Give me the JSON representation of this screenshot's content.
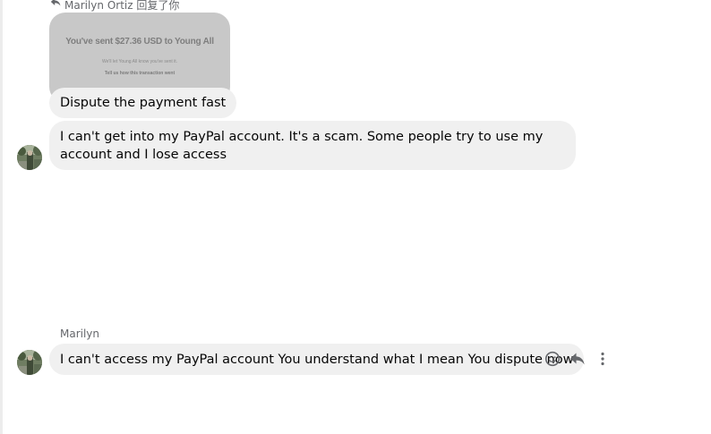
{
  "reply_header": {
    "icon": "reply-arrow-icon",
    "text": "Marilyn Ortiz 回复了你"
  },
  "shared_image": {
    "headline": "You've sent $27.36 USD to Young All",
    "subtext": "We'll let Young All know you've sent it.",
    "link": "Tell us how this transaction went"
  },
  "messages": [
    {
      "text": "Dispute the payment fast"
    },
    {
      "text": "I can't get into my PayPal account. It's a scam. Some people try to use my account and I lose access"
    },
    {
      "sender": "Marilyn",
      "text": "I can't access my PayPal account You understand what I mean You dispute now"
    }
  ],
  "actions": [
    {
      "icon": "smiley-reaction-icon"
    },
    {
      "icon": "reply-arrow-icon"
    },
    {
      "icon": "more-vertical-icon"
    }
  ],
  "colors": {
    "bubble_bg": "#f0f0f0",
    "meta_text": "#65676b",
    "icon_color": "#65676b"
  }
}
